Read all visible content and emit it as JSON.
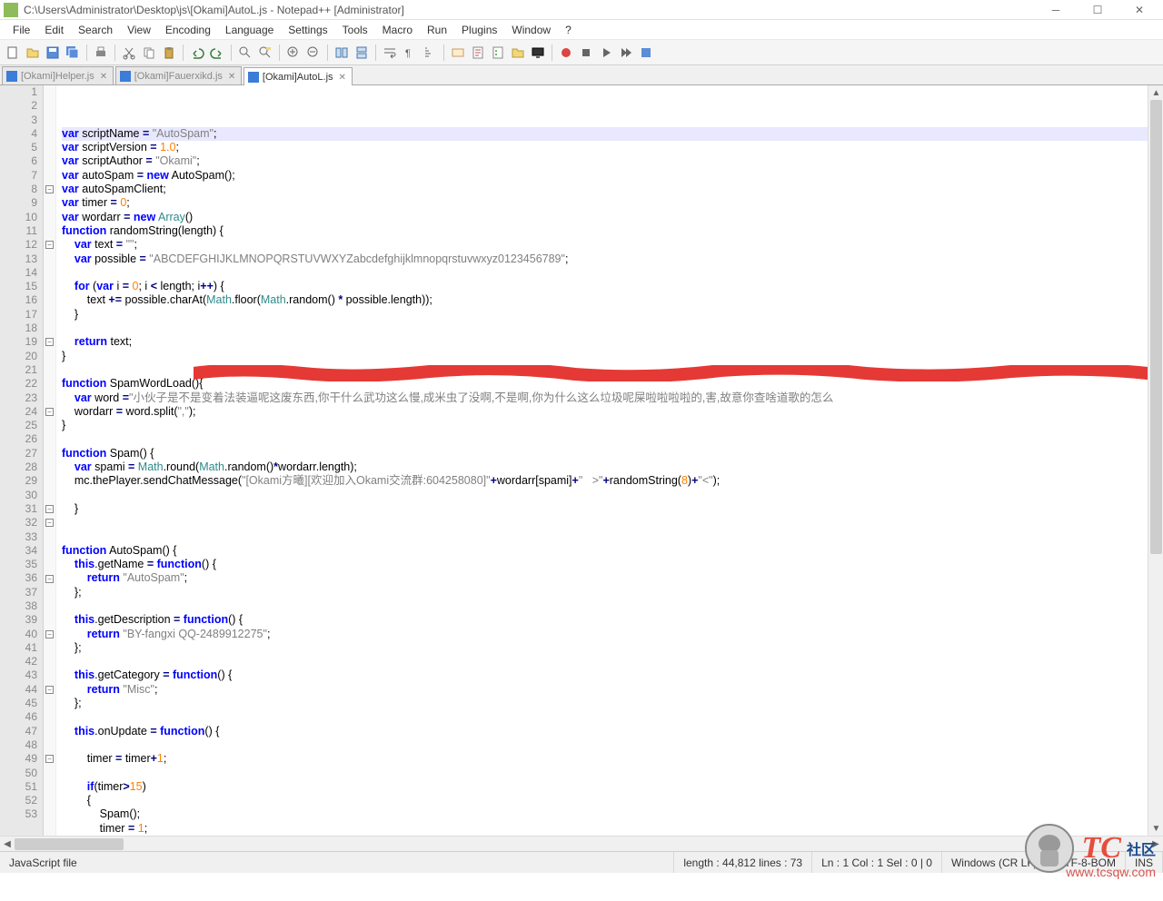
{
  "window": {
    "title": "C:\\Users\\Administrator\\Desktop\\js\\[Okami]AutoL.js - Notepad++ [Administrator]"
  },
  "menu": [
    "File",
    "Edit",
    "Search",
    "View",
    "Encoding",
    "Language",
    "Settings",
    "Tools",
    "Macro",
    "Run",
    "Plugins",
    "Window",
    "?"
  ],
  "tabs": [
    {
      "label": "[Okami]Helper.js",
      "active": false
    },
    {
      "label": "[Okami]Fauerxikd.js",
      "active": false
    },
    {
      "label": "[Okami]AutoL.js",
      "active": true
    }
  ],
  "lines": [
    {
      "n": 1,
      "hl": true,
      "html": "<span class='kw'>var</span> scriptName <span class='op'>=</span> <span class='str'>\"AutoSpam\"</span>;"
    },
    {
      "n": 2,
      "html": "<span class='kw'>var</span> scriptVersion <span class='op'>=</span> <span class='num'>1.0</span>;"
    },
    {
      "n": 3,
      "html": "<span class='kw'>var</span> scriptAuthor <span class='op'>=</span> <span class='str'>\"Okami\"</span>;"
    },
    {
      "n": 4,
      "html": "<span class='kw'>var</span> autoSpam <span class='op'>=</span> <span class='kw'>new</span> AutoSpam();"
    },
    {
      "n": 5,
      "html": "<span class='kw'>var</span> autoSpamClient;"
    },
    {
      "n": 6,
      "html": "<span class='kw'>var</span> timer <span class='op'>=</span> <span class='num'>0</span>;"
    },
    {
      "n": 7,
      "html": "<span class='kw'>var</span> wordarr <span class='op'>=</span> <span class='kw'>new</span> <span class='cls'>Array</span>()"
    },
    {
      "n": 8,
      "fold": true,
      "html": "<span class='kw'>function</span> randomString(length) {"
    },
    {
      "n": 9,
      "html": "    <span class='kw'>var</span> text <span class='op'>=</span> <span class='str'>\"\"</span>;"
    },
    {
      "n": 10,
      "html": "    <span class='kw'>var</span> possible <span class='op'>=</span> <span class='str'>\"ABCDEFGHIJKLMNOPQRSTUVWXYZabcdefghijklmnopqrstuvwxyz0123456789\"</span>;"
    },
    {
      "n": 11,
      "html": ""
    },
    {
      "n": 12,
      "fold": true,
      "html": "    <span class='kw'>for</span> (<span class='kw'>var</span> i <span class='op'>=</span> <span class='num'>0</span>; i <span class='op'>&lt;</span> length; i<span class='op'>++</span>) {"
    },
    {
      "n": 13,
      "html": "        text <span class='op'>+=</span> possible.charAt(<span class='cls'>Math</span>.floor(<span class='cls'>Math</span>.random() <span class='op'>*</span> possible.length));"
    },
    {
      "n": 14,
      "html": "    }"
    },
    {
      "n": 15,
      "html": ""
    },
    {
      "n": 16,
      "html": "    <span class='kw'>return</span> text;"
    },
    {
      "n": 17,
      "html": "}"
    },
    {
      "n": 18,
      "html": ""
    },
    {
      "n": 19,
      "fold": true,
      "html": "<span class='kw'>function</span> SpamWordLoad(){"
    },
    {
      "n": 20,
      "html": "    <span class='kw'>var</span> word <span class='op'>=</span><span class='str'>\"小伙子是不是变着法装逼呢这废东西,你干什么武功这么慢,成米虫了没啊,不是啊,你为什么这么垃圾呢屎啦啦啦啦的,害,故意你查啥道歌的怎么</span>"
    },
    {
      "n": 21,
      "html": "    wordarr <span class='op'>=</span> word.split(<span class='str'>\",\"</span>);"
    },
    {
      "n": 22,
      "html": "}"
    },
    {
      "n": 23,
      "html": ""
    },
    {
      "n": 24,
      "fold": true,
      "html": "<span class='kw'>function</span> Spam() {"
    },
    {
      "n": 25,
      "html": "    <span class='kw'>var</span> spami <span class='op'>=</span> <span class='cls'>Math</span>.round(<span class='cls'>Math</span>.random()<span class='op'>*</span>wordarr.length);"
    },
    {
      "n": 26,
      "html": "    mc.thePlayer.sendChatMessage(<span class='str'>\"[Okami方曦][欢迎加入Okami交流群:604258080]\"</span><span class='op'>+</span>wordarr[spami]<span class='op'>+</span><span class='str'>\"   &gt;\"</span><span class='op'>+</span>randomString(<span class='num'>8</span>)<span class='op'>+</span><span class='str'>\"&lt;\"</span>);"
    },
    {
      "n": 27,
      "html": ""
    },
    {
      "n": 28,
      "html": "    }"
    },
    {
      "n": 29,
      "html": ""
    },
    {
      "n": 30,
      "html": ""
    },
    {
      "n": 31,
      "fold": true,
      "html": "<span class='kw'>function</span> AutoSpam() {"
    },
    {
      "n": 32,
      "fold": true,
      "html": "    <span class='kw'>this</span>.getName <span class='op'>=</span> <span class='kw'>function</span>() {"
    },
    {
      "n": 33,
      "html": "        <span class='kw'>return</span> <span class='str'>\"AutoSpam\"</span>;"
    },
    {
      "n": 34,
      "html": "    };"
    },
    {
      "n": 35,
      "html": ""
    },
    {
      "n": 36,
      "fold": true,
      "html": "    <span class='kw'>this</span>.getDescription <span class='op'>=</span> <span class='kw'>function</span>() {"
    },
    {
      "n": 37,
      "html": "        <span class='kw'>return</span> <span class='str'>\"BY-fangxi QQ-2489912275\"</span>;"
    },
    {
      "n": 38,
      "html": "    };"
    },
    {
      "n": 39,
      "html": ""
    },
    {
      "n": 40,
      "fold": true,
      "html": "    <span class='kw'>this</span>.getCategory <span class='op'>=</span> <span class='kw'>function</span>() {"
    },
    {
      "n": 41,
      "html": "        <span class='kw'>return</span> <span class='str'>\"Misc\"</span>;"
    },
    {
      "n": 42,
      "html": "    };"
    },
    {
      "n": 43,
      "html": ""
    },
    {
      "n": 44,
      "fold": true,
      "html": "    <span class='kw'>this</span>.onUpdate <span class='op'>=</span> <span class='kw'>function</span>() {"
    },
    {
      "n": 45,
      "html": ""
    },
    {
      "n": 46,
      "html": "        timer <span class='op'>=</span> timer<span class='op'>+</span><span class='num'>1</span>;"
    },
    {
      "n": 47,
      "html": ""
    },
    {
      "n": 48,
      "html": "        <span class='kw'>if</span>(timer<span class='op'>&gt;</span><span class='num'>15</span>)"
    },
    {
      "n": 49,
      "fold": true,
      "html": "        {"
    },
    {
      "n": 50,
      "html": "            Spam();"
    },
    {
      "n": 51,
      "html": "            timer <span class='op'>=</span> <span class='num'>1</span>;"
    },
    {
      "n": 52,
      "html": "        }"
    },
    {
      "n": 53,
      "html": ""
    }
  ],
  "status": {
    "filetype": "JavaScript file",
    "length": "length : 44,812    lines : 73",
    "pos": "Ln : 1    Col : 1    Sel : 0 | 0",
    "eol": "Windows (CR LF)",
    "enc": "UTF-8-BOM",
    "ins": "INS"
  },
  "watermark": {
    "t1": "TC",
    "t2": "社区",
    "url": "www.tcsqw.com"
  }
}
